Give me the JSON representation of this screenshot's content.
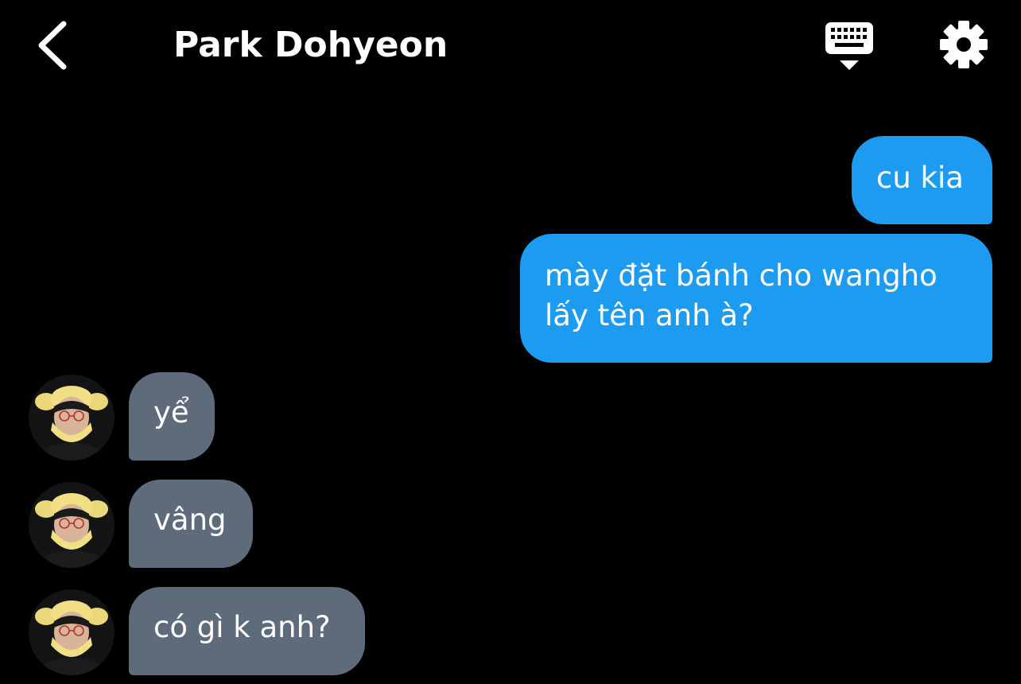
{
  "header": {
    "title": "Park Dohyeon",
    "back_icon": "chevron-left-icon",
    "keyboard_icon": "keyboard-hide-icon",
    "settings_icon": "gear-icon"
  },
  "colors": {
    "background": "#000000",
    "sent_bubble": "#1d9bf0",
    "received_bubble": "#5e6b7b",
    "text": "#ffffff"
  },
  "messages": [
    {
      "from": "me",
      "text": "cu kia"
    },
    {
      "from": "me",
      "text": "mày đặt bánh cho wangho\nlấy tên anh à?"
    },
    {
      "from": "Park Dohyeon",
      "text": "yể"
    },
    {
      "from": "Park Dohyeon",
      "text": "vâng"
    },
    {
      "from": "Park Dohyeon",
      "text": "có gì k anh?"
    }
  ]
}
